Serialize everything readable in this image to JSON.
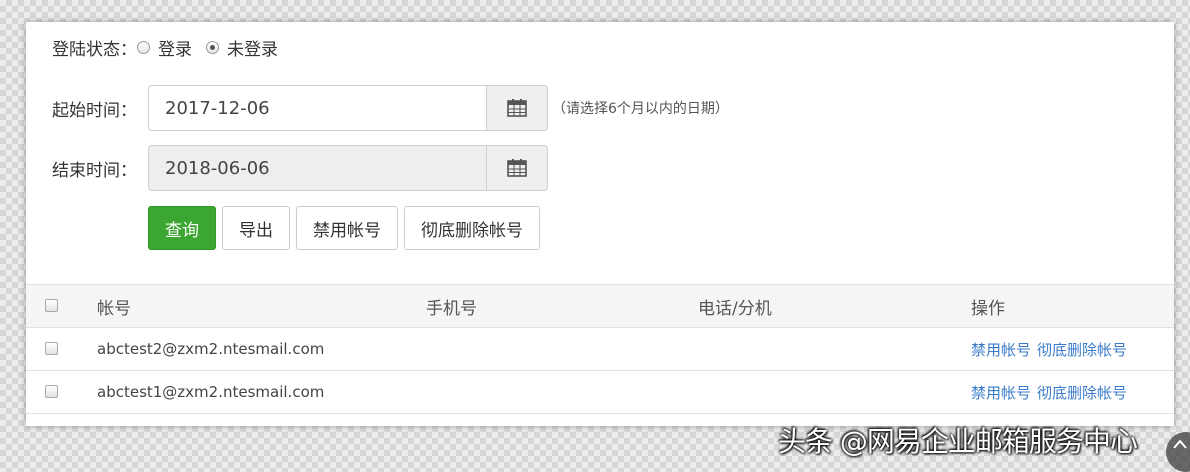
{
  "login_status": {
    "label": "登陆状态：",
    "options": [
      {
        "label": "登录",
        "checked": false
      },
      {
        "label": "未登录",
        "checked": true
      }
    ]
  },
  "start_date": {
    "label": "起始时间：",
    "value": "2017-12-06",
    "hint": "（请选择6个月以内的日期）"
  },
  "end_date": {
    "label": "结束时间：",
    "value": "2018-06-06"
  },
  "buttons": {
    "query": "查询",
    "export": "导出",
    "disable": "禁用帐号",
    "delete": "彻底删除帐号"
  },
  "table": {
    "headers": {
      "account": "帐号",
      "mobile": "手机号",
      "phone": "电话/分机",
      "ops": "操作"
    },
    "rows": [
      {
        "account": "abctest2@zxm2.ntesmail.com",
        "mobile": "",
        "phone": "",
        "disable": "禁用帐号",
        "delete": "彻底删除帐号"
      },
      {
        "account": "abctest1@zxm2.ntesmail.com",
        "mobile": "",
        "phone": "",
        "disable": "禁用帐号",
        "delete": "彻底删除帐号"
      }
    ]
  },
  "watermark": "头条 @网易企业邮箱服务中心",
  "colors": {
    "primary": "#3ca632",
    "link": "#3a7bc8"
  }
}
